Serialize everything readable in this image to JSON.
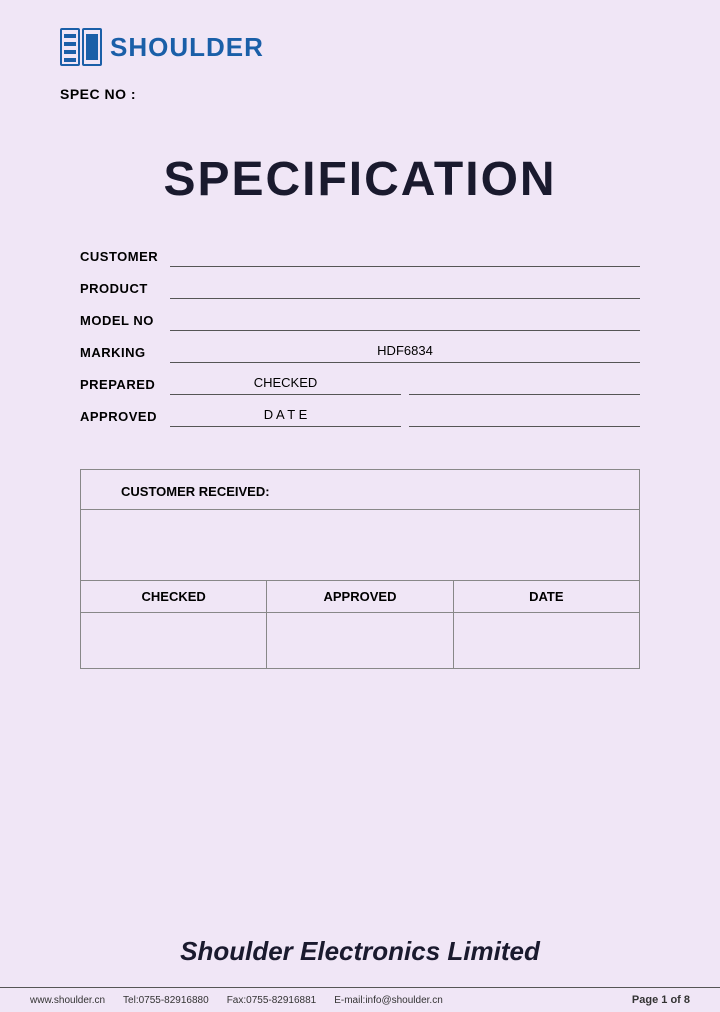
{
  "logo": {
    "text": "SHOULDER"
  },
  "spec_no_label": "SPEC NO :",
  "main_title": "SPECIFICATION",
  "fields": {
    "customer_label": "CUSTOMER",
    "product_label": "PRODUCT",
    "model_no_label": "MODEL NO",
    "marking_label": "MARKING",
    "marking_value": "HDF6834",
    "prepared_label": "PREPARED",
    "prepared_value": "CHECKED",
    "approved_label": "APPROVED",
    "approved_value": "D A T E"
  },
  "customer_received": {
    "label": "CUSTOMER RECEIVED:",
    "col1": "CHECKED",
    "col2": "APPROVED",
    "col3": "DATE"
  },
  "company_name": "Shoulder Electronics Limited",
  "footer": {
    "website": "www.shoulder.cn",
    "tel": "Tel:0755-82916880",
    "fax": "Fax:0755-82916881",
    "email": "E-mail:info@shoulder.cn",
    "page": "Page 1 of 8"
  }
}
